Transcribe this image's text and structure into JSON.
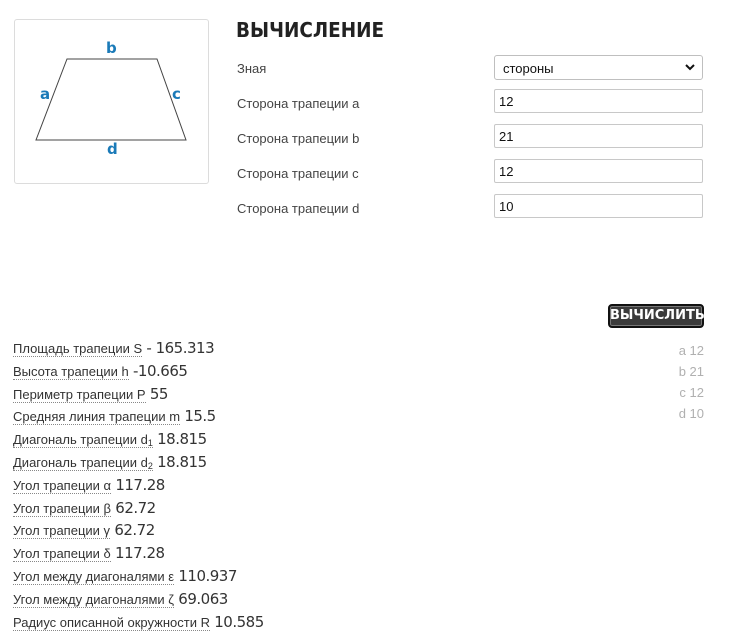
{
  "figure": {
    "labels": {
      "a": "a",
      "b": "b",
      "c": "c",
      "d": "d"
    },
    "accent_color": "#1a7ab8"
  },
  "header": {
    "title": "ВЫЧИСЛЕНИЕ"
  },
  "form": {
    "known_label": "Зная",
    "known_selected": "стороны",
    "side_a_label": "Сторона трапеции a",
    "side_a_value": "12",
    "side_b_label": "Сторона трапеции b",
    "side_b_value": "21",
    "side_c_label": "Сторона трапеции c",
    "side_c_value": "12",
    "side_d_label": "Сторона трапеции d",
    "side_d_value": "10"
  },
  "calculate_label": "ВЫЧИСЛИТЬ",
  "summary": [
    "a 12",
    "b 21",
    "c 12",
    "d 10"
  ],
  "results": [
    {
      "label": "Площадь трапеции S",
      "sub": "",
      "value": "- 165.313"
    },
    {
      "label": "Высота трапеции h",
      "sub": "",
      "value": "-10.665"
    },
    {
      "label": "Периметр трапеции P",
      "sub": "",
      "value": "55"
    },
    {
      "label": "Средняя линия трапеции m",
      "sub": "",
      "value": "15.5"
    },
    {
      "label": "Диагональ трапеции d",
      "sub": "1",
      "value": "18.815"
    },
    {
      "label": "Диагональ трапеции d",
      "sub": "2",
      "value": "18.815"
    },
    {
      "label": "Угол трапеции α",
      "sub": "",
      "value": "117.28"
    },
    {
      "label": "Угол трапеции β",
      "sub": "",
      "value": "62.72"
    },
    {
      "label": "Угол трапеции γ",
      "sub": "",
      "value": "62.72"
    },
    {
      "label": "Угол трапеции δ",
      "sub": "",
      "value": "117.28"
    },
    {
      "label": "Угол между диагоналями ε",
      "sub": "",
      "value": "110.937"
    },
    {
      "label": "Угол между диагоналями ζ",
      "sub": "",
      "value": "69.063"
    },
    {
      "label": "Радиус описанной окружности R",
      "sub": "",
      "value": "10.585"
    }
  ]
}
